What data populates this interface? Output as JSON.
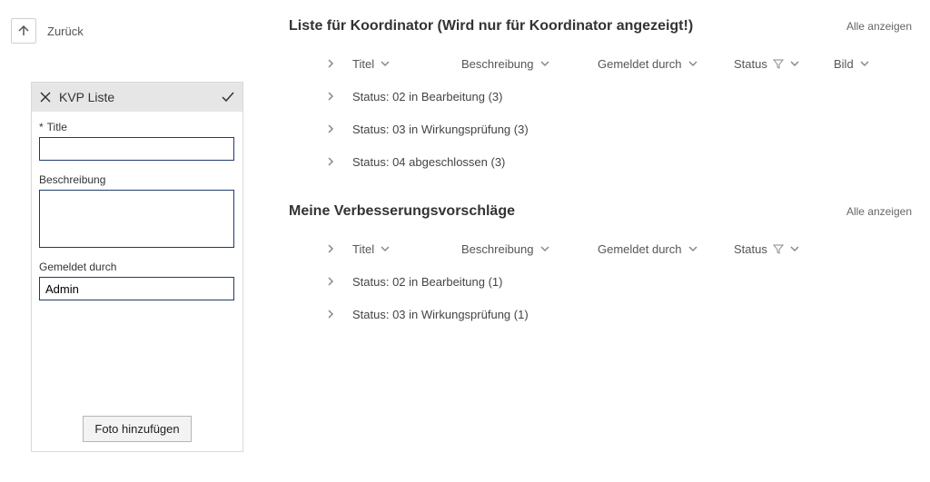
{
  "back": {
    "label": "Zurück"
  },
  "form": {
    "title": "KVP Liste",
    "fields": {
      "title_label": "Title",
      "title_value": "",
      "description_label": "Beschreibung",
      "description_value": "",
      "reporter_label": "Gemeldet durch",
      "reporter_value": "Admin"
    },
    "add_photo_label": "Foto hinzufügen"
  },
  "lists": {
    "koord": {
      "title": "Liste für Koordinator (Wird nur für Koordinator angezeigt!)",
      "show_all": "Alle anzeigen",
      "columns": {
        "titel": "Titel",
        "beschreibung": "Beschreibung",
        "gemeldet": "Gemeldet durch",
        "status": "Status",
        "bild": "Bild"
      },
      "groups": [
        "Status: 02 in Bearbeitung (3)",
        "Status: 03 in Wirkungsprüfung (3)",
        "Status: 04 abgeschlossen (3)"
      ]
    },
    "meine": {
      "title": "Meine Verbesserungsvorschläge",
      "show_all": "Alle anzeigen",
      "columns": {
        "titel": "Titel",
        "beschreibung": "Beschreibung",
        "gemeldet": "Gemeldet durch",
        "status": "Status"
      },
      "groups": [
        "Status: 02 in Bearbeitung (1)",
        "Status: 03 in Wirkungsprüfung (1)"
      ]
    }
  }
}
